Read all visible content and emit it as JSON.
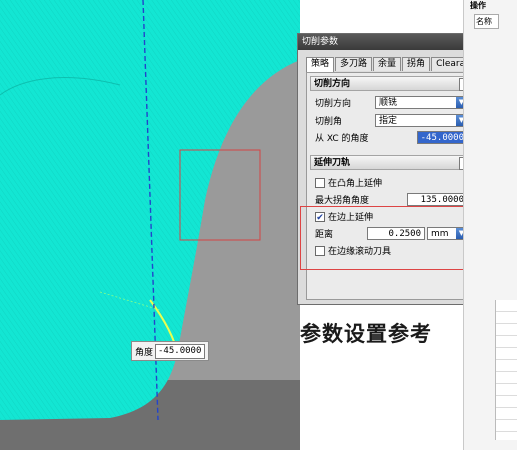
{
  "viewport": {
    "angle_tag": {
      "label": "角度",
      "value": "-45.0000"
    }
  },
  "dialog": {
    "title": "切削参数",
    "tabs": [
      {
        "label": "策略",
        "active": true
      },
      {
        "label": "多刀路",
        "active": false
      },
      {
        "label": "余量",
        "active": false
      },
      {
        "label": "拐角",
        "active": false
      },
      {
        "label": "Clearances",
        "active": false
      }
    ],
    "cut_direction_group": {
      "title": "切削方向",
      "cut_direction_label": "切削方向",
      "cut_direction_value": "顺铣",
      "cut_angle_label": "切削角",
      "cut_angle_value": "指定",
      "from_xc_label": "从 XC 的角度",
      "from_xc_value": "-45.0000"
    },
    "extend_group": {
      "title": "延伸刀轨",
      "convex_corner_label": "在凸角上延伸",
      "convex_corner_checked": false,
      "max_corner_label": "最大拐角角度",
      "max_corner_value": "135.0000",
      "edge_extend_label": "在边上延伸",
      "edge_extend_checked": true,
      "distance_label": "距离",
      "distance_value": "0.2500",
      "distance_unit": "mm",
      "edge_roll_label": "在边缘滚动刀具",
      "edge_roll_checked": false
    },
    "toggle_glyph": "∧",
    "dropdown_glyph": "▼",
    "check_glyph": "✔"
  },
  "caption": "参数设置参考",
  "side_doc": {
    "header": "操作",
    "name_label": "名称"
  },
  "colors": {
    "surface": "#00e3d0",
    "toolpath_dash": "#2244cc",
    "highlight_box": "#d44444",
    "viewport_bg": "#9a9a9a"
  }
}
